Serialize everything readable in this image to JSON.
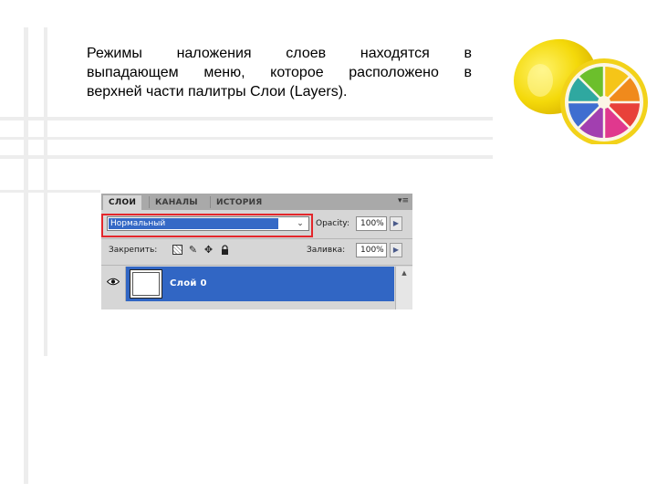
{
  "slide": {
    "lines": [
      "Режимы наложения слоев находятся в",
      "выпадающем меню, которое расположено в",
      "верхней части палитры Слои (Layers)."
    ]
  },
  "panel": {
    "tabs": [
      "СЛОИ",
      "КАНАЛЫ",
      "ИСТОРИЯ"
    ],
    "active_tab": "СЛОИ",
    "menu_icon": "▾≡",
    "blend_mode": "Нормальный",
    "blend_arrow": "⌄",
    "opacity_label": "Opacity:",
    "opacity_value": "100%",
    "lock_label": "Закрепить:",
    "fill_label": "Заливка:",
    "fill_value": "100%",
    "arrow": "▶",
    "layer_name": "Слой 0",
    "scroll_up": "▲"
  },
  "colors": {
    "highlight": "#e3262b",
    "selection": "#3166c4"
  },
  "icons": [
    "lock-transparent-pixels-icon",
    "lock-brush-icon",
    "lock-move-icon",
    "lock-all-icon",
    "eye-icon",
    "panel-menu-icon"
  ]
}
